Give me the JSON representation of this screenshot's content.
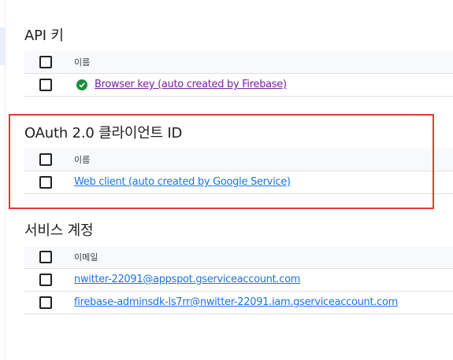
{
  "api_keys": {
    "title": "API 키",
    "column_name": "이름",
    "rows": [
      {
        "name": "Browser key (auto created by Firebase)"
      }
    ]
  },
  "oauth": {
    "title": "OAuth 2.0 클라이언트 ID",
    "column_name": "이름",
    "rows": [
      {
        "name": "Web client (auto created by Google Service)"
      }
    ]
  },
  "service_accounts": {
    "title": "서비스 계정",
    "column_email": "이메일",
    "rows": [
      {
        "email": "nwitter-22091@appspot.gserviceaccount.com"
      },
      {
        "email": "firebase-adminsdk-ls7rr@nwitter-22091.iam.gserviceaccount.com"
      }
    ]
  },
  "colors": {
    "link": "#1a73e8",
    "visited_link": "#7b1fa2",
    "status_ok": "#1e8e3e",
    "highlight": "#e53935"
  }
}
